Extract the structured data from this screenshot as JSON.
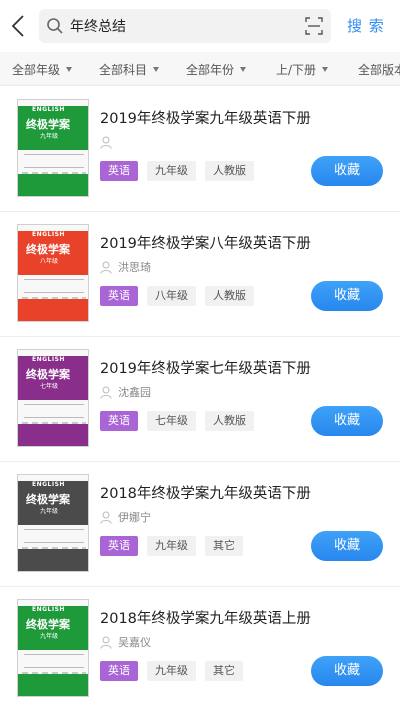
{
  "search": {
    "query": "年终总结",
    "button_label": "搜 索"
  },
  "filters": [
    {
      "label": "全部年级"
    },
    {
      "label": "全部科目"
    },
    {
      "label": "全部年份"
    },
    {
      "label": "上/下册"
    },
    {
      "label": "全部版本"
    }
  ],
  "books": [
    {
      "title": "2019年终极学案九年级英语下册",
      "author": "",
      "tags": [
        "英语",
        "九年级",
        "人教版"
      ],
      "fav_label": "收藏",
      "cover": {
        "color": "#1f9a3a",
        "logo": "ENGLISH",
        "title": "终极学案",
        "grade": "九年级"
      }
    },
    {
      "title": "2019年终极学案八年级英语下册",
      "author": "洪思琦",
      "tags": [
        "英语",
        "八年级",
        "人教版"
      ],
      "fav_label": "收藏",
      "cover": {
        "color": "#e8432a",
        "logo": "ENGLISH",
        "title": "终极学案",
        "grade": "八年级"
      }
    },
    {
      "title": "2019年终极学案七年级英语下册",
      "author": "沈鑫园",
      "tags": [
        "英语",
        "七年级",
        "人教版"
      ],
      "fav_label": "收藏",
      "cover": {
        "color": "#8a2e8c",
        "logo": "ENGLISH",
        "title": "终极学案",
        "grade": "七年级"
      }
    },
    {
      "title": "2018年终极学案九年级英语下册",
      "author": "伊娜宁",
      "tags": [
        "英语",
        "九年级",
        "其它"
      ],
      "fav_label": "收藏",
      "cover": {
        "color": "#4b4b4b",
        "logo": "ENGLISH",
        "title": "终极学案",
        "grade": "九年级"
      }
    },
    {
      "title": "2018年终极学案九年级英语上册",
      "author": "吴嘉仪",
      "tags": [
        "英语",
        "九年级",
        "其它"
      ],
      "fav_label": "收藏",
      "cover": {
        "color": "#1f9a3a",
        "logo": "ENGLISH",
        "title": "终极学案",
        "grade": "九年级"
      }
    }
  ],
  "colors": {
    "accent": "#2f8df3",
    "subject_tag": "#a964d6"
  }
}
